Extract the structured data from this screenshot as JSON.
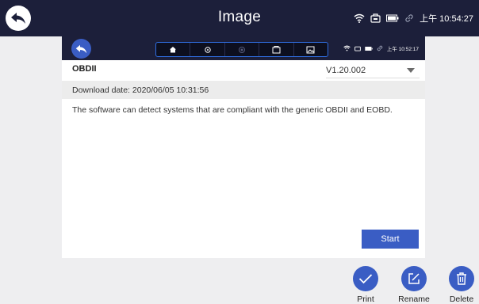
{
  "header": {
    "title": "Image",
    "time": "上午 10:54:27"
  },
  "screenshot": {
    "status_time": "上午 10:52:17",
    "software_name": "OBDII",
    "version": "V1.20.002",
    "download_date": "Download date: 2020/06/05 10:31:56",
    "description": "The software can detect systems that are compliant with the generic OBDII and EOBD.",
    "start_label": "Start",
    "tabs": [
      "home-icon",
      "settings-icon",
      "record-icon",
      "vci-icon",
      "image-icon"
    ]
  },
  "actions": {
    "print_label": "Print",
    "rename_label": "Rename",
    "delete_label": "Delete"
  },
  "colors": {
    "bar": "#1c1f3a",
    "accent": "#3a5dc4"
  }
}
